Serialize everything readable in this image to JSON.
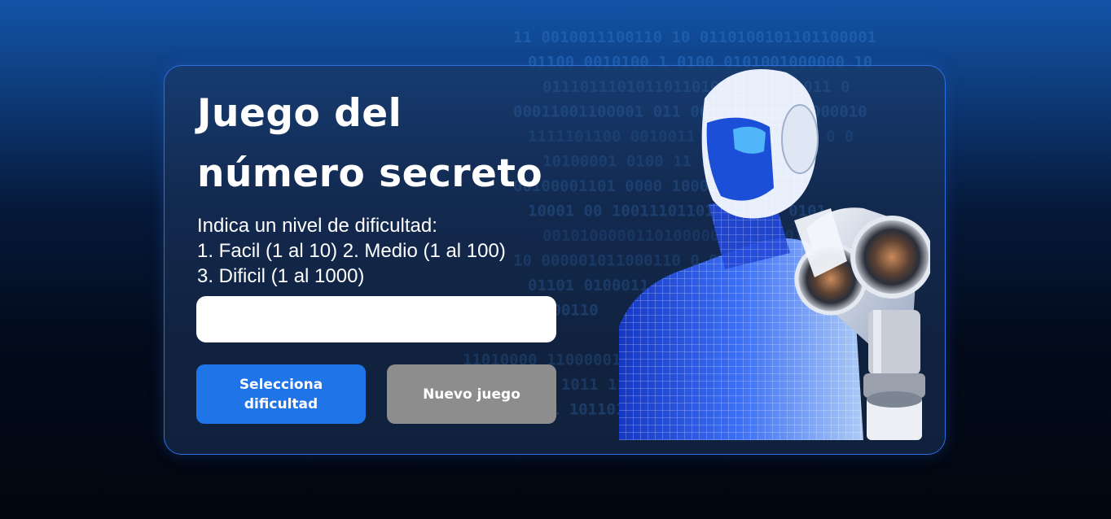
{
  "game": {
    "title_line1": "Juego del",
    "title_line2": "número secreto",
    "instruction_lines": [
      "Indica un nivel de dificultad:",
      "1. Facil (1 al 10) 2. Medio (1 al 100)",
      "3. Dificil (1 al 1000)"
    ],
    "input_value": "",
    "buttons": {
      "select_difficulty": "Selecciona dificultad",
      "new_game": "Nuevo juego"
    }
  },
  "background": {
    "binary_rows": [
      "11 0010011100110 10 0110100101101100001",
      "01100 0010100 1 0100 0101001000000 10",
      "0111011101011011010100011101011 0",
      "00011001100001 011 001111 101101000010",
      "1111101100 0010011 000110000011 0 0",
      "10100001 0100 11 10011 001011",
      "00100001101 0000 1000 001 10",
      "10001 00 100111011010000 00 0101",
      "0010100000110100000 10100 0100011 00",
      "10 000001011000110 0 0",
      "01101 0100011 1 01000",
      "01 110 000110",
      "01100 1010",
      "11010000 11000001 1 0 11 100",
      "00 01111 1011 11011",
      "10100 010 11 101101000 101100101 010 0110"
    ]
  },
  "colors": {
    "accent_blue": "#1f74e8",
    "neutral_button": "#8d8d8d",
    "card_border": "#2e6ee0",
    "binary_text": "#3b8ee6"
  }
}
